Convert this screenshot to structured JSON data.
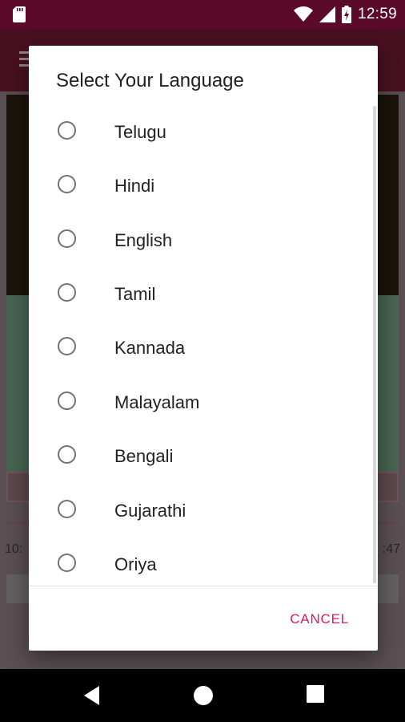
{
  "status_bar": {
    "time": "12:59",
    "icons": [
      "sd-card-icon",
      "wifi-icon",
      "signal-icon",
      "battery-charging-icon"
    ]
  },
  "background_app": {
    "time_left": "10:",
    "time_right": ":47"
  },
  "dialog": {
    "title": "Select Your Language",
    "options": [
      {
        "label": "Telugu",
        "selected": false
      },
      {
        "label": "Hindi",
        "selected": false
      },
      {
        "label": "English",
        "selected": false
      },
      {
        "label": "Tamil",
        "selected": false
      },
      {
        "label": "Kannada",
        "selected": false
      },
      {
        "label": "Malayalam",
        "selected": false
      },
      {
        "label": "Bengali",
        "selected": false
      },
      {
        "label": "Gujarathi",
        "selected": false
      },
      {
        "label": "Oriya",
        "selected": false
      }
    ],
    "cancel_label": "CANCEL"
  },
  "colors": {
    "accent": "#d81b60",
    "status_bar": "#5c0a2a",
    "toolbar": "#6e1934",
    "radio_outline": "#737373"
  },
  "nav_bar": {
    "icons": [
      "back-icon",
      "home-icon",
      "recents-icon"
    ]
  }
}
